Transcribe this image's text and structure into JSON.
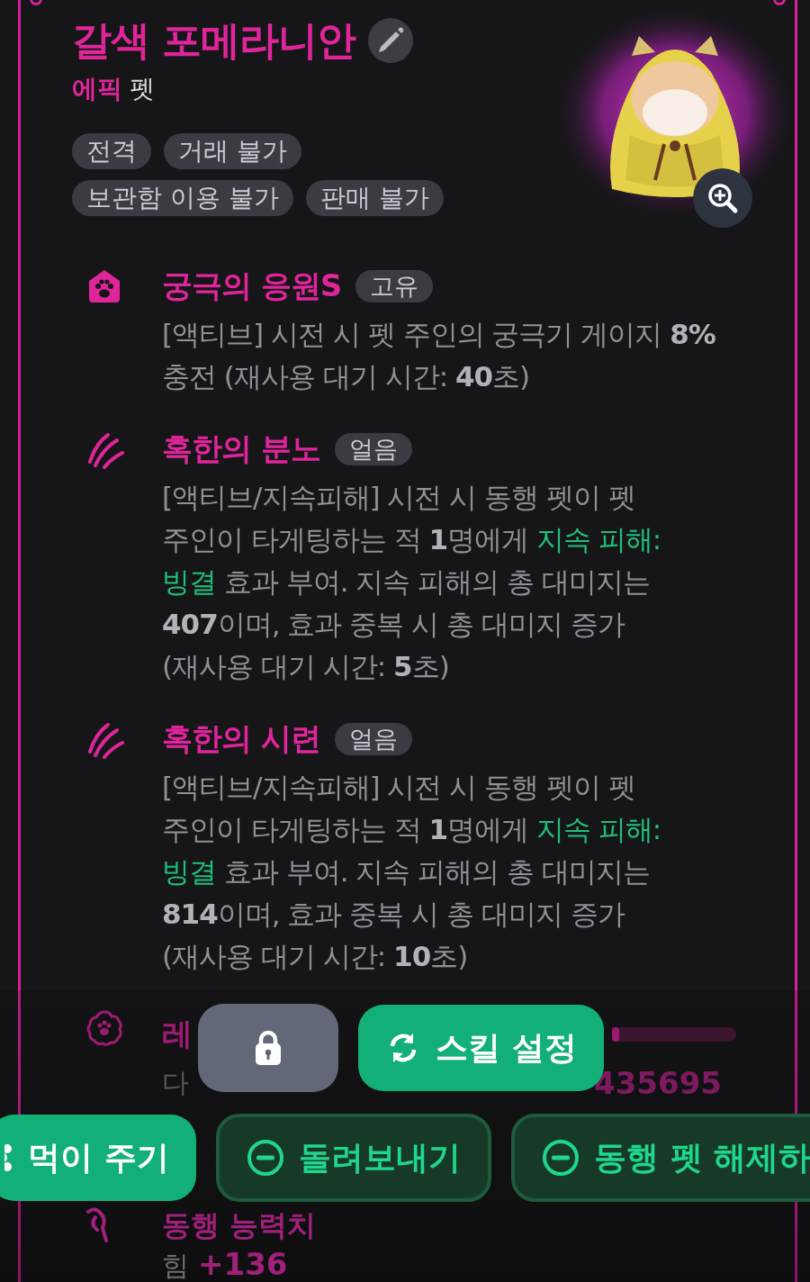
{
  "pet": {
    "name": "갈색 포메라니안",
    "grade": "에픽",
    "type": "펫",
    "tags": [
      "전격",
      "거래 불가",
      "보관함 이용 불가",
      "판매 불가"
    ],
    "portrait": {
      "kind": "picture"
    }
  },
  "skills": [
    {
      "name": "궁극의 응원S",
      "badge": "고유",
      "description": [
        {
          "kind": "plain",
          "text": "[액티브] 시전 시 펫 주인의 궁극기 게이지 **8%** 충전 (재사용 대기 시간: **40**초)"
        }
      ]
    },
    {
      "name": "혹한의 분노",
      "badge": "얼음",
      "description": [
        {
          "kind": "plain",
          "text": "[액티브/지속피해] 시전 시 동행 펫이 펫 주인이 타게팅하는 적 **1**명에게 "
        },
        {
          "kind": "effect",
          "text": "지속 피해: 빙결"
        },
        {
          "kind": "plain",
          "text": " 효과 부여. 지속 피해의 총 대미지는 **407**이며, 효과 중복 시 총 대미지 증가 (재사용 대기 시간: **5**초)"
        }
      ]
    },
    {
      "name": "혹한의 시련",
      "badge": "얼음",
      "description": [
        {
          "kind": "plain",
          "text": "[액티브/지속피해] 시전 시 동행 펫이 펫 주인이 타게팅하는 적 **1**명에게 "
        },
        {
          "kind": "effect",
          "text": "지속 피해: 빙결"
        },
        {
          "kind": "plain",
          "text": " 효과 부여. 지속 피해의 총 대미지는 **814**이며, 효과 중복 시 총 대미지 증가 (재사용 대기 시간: **10**초)"
        }
      ]
    }
  ],
  "level_section": {
    "title": "레",
    "progress": {
      "level": 0.06
    },
    "next_label": "다",
    "exp": "435695"
  },
  "stats": {
    "title": "동행 능력치",
    "items": [
      {
        "name": "힘",
        "value": "+136"
      }
    ]
  },
  "buttons": [
    {
      "kind": "lock"
    },
    {
      "kind": "primary",
      "label": "스킬 설정"
    },
    {
      "kind": "primary",
      "label": "먹이 주기"
    },
    {
      "kind": "outline",
      "label": "돌려보내기"
    },
    {
      "kind": "outline",
      "label": "동행 펫 해제하"
    }
  ]
}
